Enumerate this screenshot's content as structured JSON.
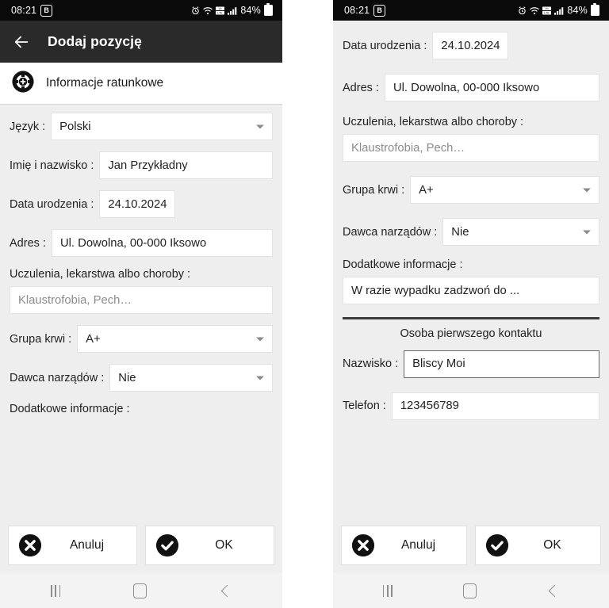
{
  "status_bar": {
    "time": "08:21",
    "badge": "B",
    "battery": "84%",
    "icons": [
      "alarm-icon",
      "wifi-icon",
      "volte-icon",
      "signal-icon",
      "battery-icon"
    ]
  },
  "app_bar": {
    "back_icon": "back-arrow-icon",
    "title": "Dodaj pozycję"
  },
  "section": {
    "icon": "life-ring-icon",
    "title": "Informacje ratunkowe"
  },
  "fields": {
    "language_label": "Język :",
    "language_value": "Polski",
    "fullname_label": "Imię i nazwisko :",
    "fullname_value": "Jan Przykładny",
    "birthdate_label": "Data urodzenia :",
    "birthdate_value": "24.10.2024",
    "address_label": "Adres :",
    "address_value": "Ul. Dowolna, 00-000 Iksowo",
    "allergies_label": "Uczulenia, lekarstwa albo choroby :",
    "allergies_placeholder": "Klaustrofobia, Pech…",
    "bloodtype_label": "Grupa krwi :",
    "bloodtype_value": "A+",
    "organdonor_label": "Dawca narządów :",
    "organdonor_value": "Nie",
    "extrainfo_label": "Dodatkowe informacje :",
    "extrainfo_value": "W razie wypadku zadzwoń do ..."
  },
  "contact": {
    "heading": "Osoba pierwszego kontaktu",
    "lastname_label": "Nazwisko :",
    "lastname_value": "Bliscy Moi",
    "phone_label": "Telefon :",
    "phone_value": "123456789"
  },
  "buttons": {
    "cancel_label": "Anuluj",
    "cancel_icon": "circle-x-icon",
    "ok_label": "OK",
    "ok_icon": "circle-check-icon"
  },
  "nav_bar": {
    "recent_icon": "recent-apps-icon",
    "home_icon": "home-icon",
    "back_icon": "nav-back-icon"
  },
  "colors": {
    "appbar_bg": "#2a2a2a",
    "statusbar_bg": "#0a0a0a",
    "page_bg": "#eeeeee",
    "field_bg": "#ffffff",
    "focus_border": "#6a6a6a"
  }
}
